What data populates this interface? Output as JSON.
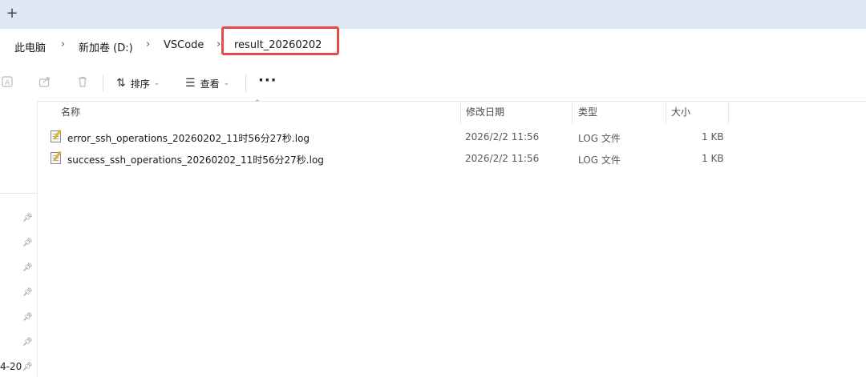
{
  "tabbar": {
    "new_tab_glyph": "+"
  },
  "breadcrumb": {
    "items": [
      "此电脑",
      "新加卷 (D:)",
      "VSCode",
      "result_20260202"
    ],
    "separator": "›",
    "highlight_color": "#e8494e"
  },
  "toolbar": {
    "sort_label": "排序",
    "view_label": "查看",
    "more_label": "···",
    "icons": [
      "rename-icon",
      "share-icon",
      "delete-icon",
      "sort-icon",
      "view-icon"
    ]
  },
  "columns": {
    "name": "名称",
    "date": "修改日期",
    "type": "类型",
    "size": "大小"
  },
  "files": [
    {
      "name": "error_ssh_operations_20260202_11时56分27秒.log",
      "date": "2026/2/2 11:56",
      "type": "LOG 文件",
      "size": "1 KB"
    },
    {
      "name": "success_ssh_operations_20260202_11时56分27秒.log",
      "date": "2026/2/2 11:56",
      "type": "LOG 文件",
      "size": "1 KB"
    }
  ],
  "nav": {
    "date_fragment": "4-20"
  }
}
